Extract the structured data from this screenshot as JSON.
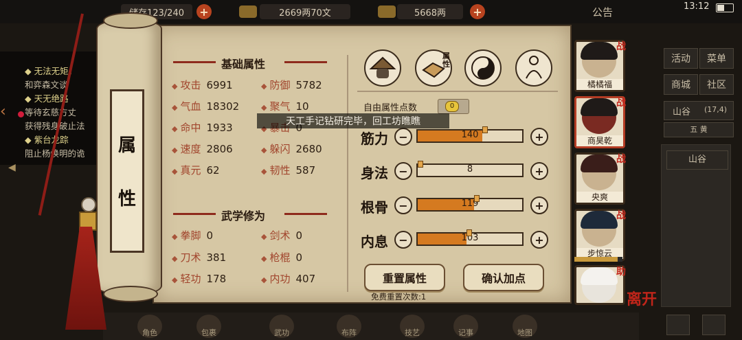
{
  "status_bar": {
    "time": "13:12"
  },
  "top_bar": {
    "bag": "储存123/240",
    "copper": "2669两70文",
    "silver": "5668两",
    "announcement": "公告"
  },
  "quest_panel": {
    "lines": [
      "◆ 无法无矩，",
      "和弈森文谈",
      "◆ 天无绝路",
      "等待玄慈方丈",
      "获得残身破止法",
      "◆ 紫台龙踪",
      "阻止杨焕明的诡"
    ]
  },
  "side_menu": {
    "buttons": [
      "活动",
      "菜单",
      "商城",
      "社区"
    ],
    "location": "山谷",
    "coords": "(17,4)",
    "time_of_day": "五 黄",
    "map_item": "山谷"
  },
  "scroll": {
    "title_chars": [
      "属",
      "性"
    ],
    "basic_header": "基础属性",
    "basic_stats": [
      {
        "name": "攻击",
        "value": "6991"
      },
      {
        "name": "防御",
        "value": "5782"
      },
      {
        "name": "气血",
        "value": "18302"
      },
      {
        "name": "聚气",
        "value": "10"
      },
      {
        "name": "命中",
        "value": "1933"
      },
      {
        "name": "暴击",
        "value": "0"
      },
      {
        "name": "速度",
        "value": "2806"
      },
      {
        "name": "躲闪",
        "value": "2680"
      },
      {
        "name": "真元",
        "value": "62"
      },
      {
        "name": "韧性",
        "value": "587"
      }
    ],
    "martial_header": "武学修为",
    "martial_stats": [
      {
        "name": "拳脚",
        "value": "0"
      },
      {
        "name": "剑术",
        "value": "0"
      },
      {
        "name": "刀术",
        "value": "381"
      },
      {
        "name": "枪棍",
        "value": "0"
      },
      {
        "name": "轻功",
        "value": "178"
      },
      {
        "name": "内功",
        "value": "407"
      }
    ],
    "tab_icons": [
      "hat-icon",
      "attribute-icon",
      "yin-yang-icon",
      "meridian-icon"
    ],
    "attribute_tab_label": "属性",
    "free_points_label": "自由属性点数",
    "free_points": "0",
    "attributes": [
      {
        "label": "筋力",
        "value": "140",
        "fill": 0.62
      },
      {
        "label": "身法",
        "value": "8",
        "fill": 0.0
      },
      {
        "label": "根骨",
        "value": "119",
        "fill": 0.54
      },
      {
        "label": "内息",
        "value": "103",
        "fill": 0.47
      }
    ],
    "reset_button": "重置属性",
    "confirm_button": "确认加点",
    "free_reset_text": "免费重置次数:1",
    "toast": "天工手记钻研完毕，回工坊瞧瞧"
  },
  "party": [
    {
      "name": "橘橘福",
      "tag": "战"
    },
    {
      "name": "商昊乾",
      "tag": "战"
    },
    {
      "name": "央爽",
      "tag": "战"
    },
    {
      "name": "步惊云",
      "tag": "战"
    },
    {
      "name": "",
      "tag": "助"
    }
  ],
  "leave_label": "离开",
  "dock": [
    "角色",
    "包裹",
    "武功",
    "布阵",
    "技艺",
    "记事",
    "地图"
  ]
}
